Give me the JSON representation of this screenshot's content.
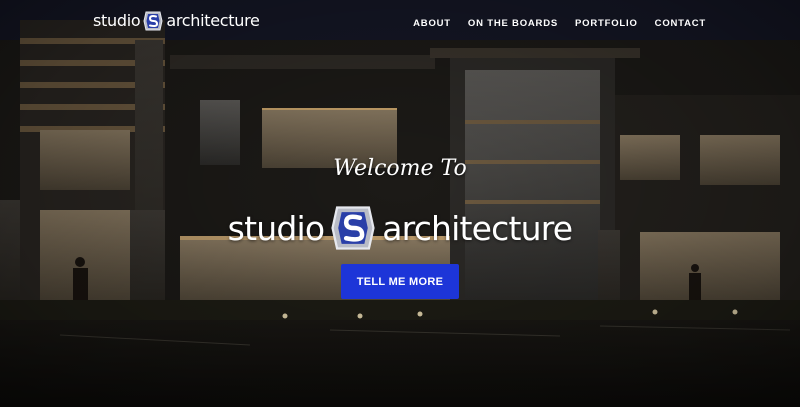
{
  "header": {
    "brand": {
      "word1": "studio",
      "word2": "architecture",
      "emblem_icon": "studio-s-emblem-icon"
    },
    "nav": [
      {
        "label": "ABOUT"
      },
      {
        "label": "ON THE BOARDS"
      },
      {
        "label": "PORTFOLIO"
      },
      {
        "label": "CONTACT"
      }
    ]
  },
  "hero": {
    "welcome": "Welcome To",
    "logo": {
      "word1": "studio",
      "word2": "architecture",
      "emblem_icon": "studio-s-emblem-icon"
    },
    "cta_label": "TELL ME MORE",
    "background_image": "modern-office-building-at-night"
  },
  "colors": {
    "cta_background": "#1d35d8",
    "emblem_blue": "#2a3fa8",
    "text": "#ffffff"
  }
}
